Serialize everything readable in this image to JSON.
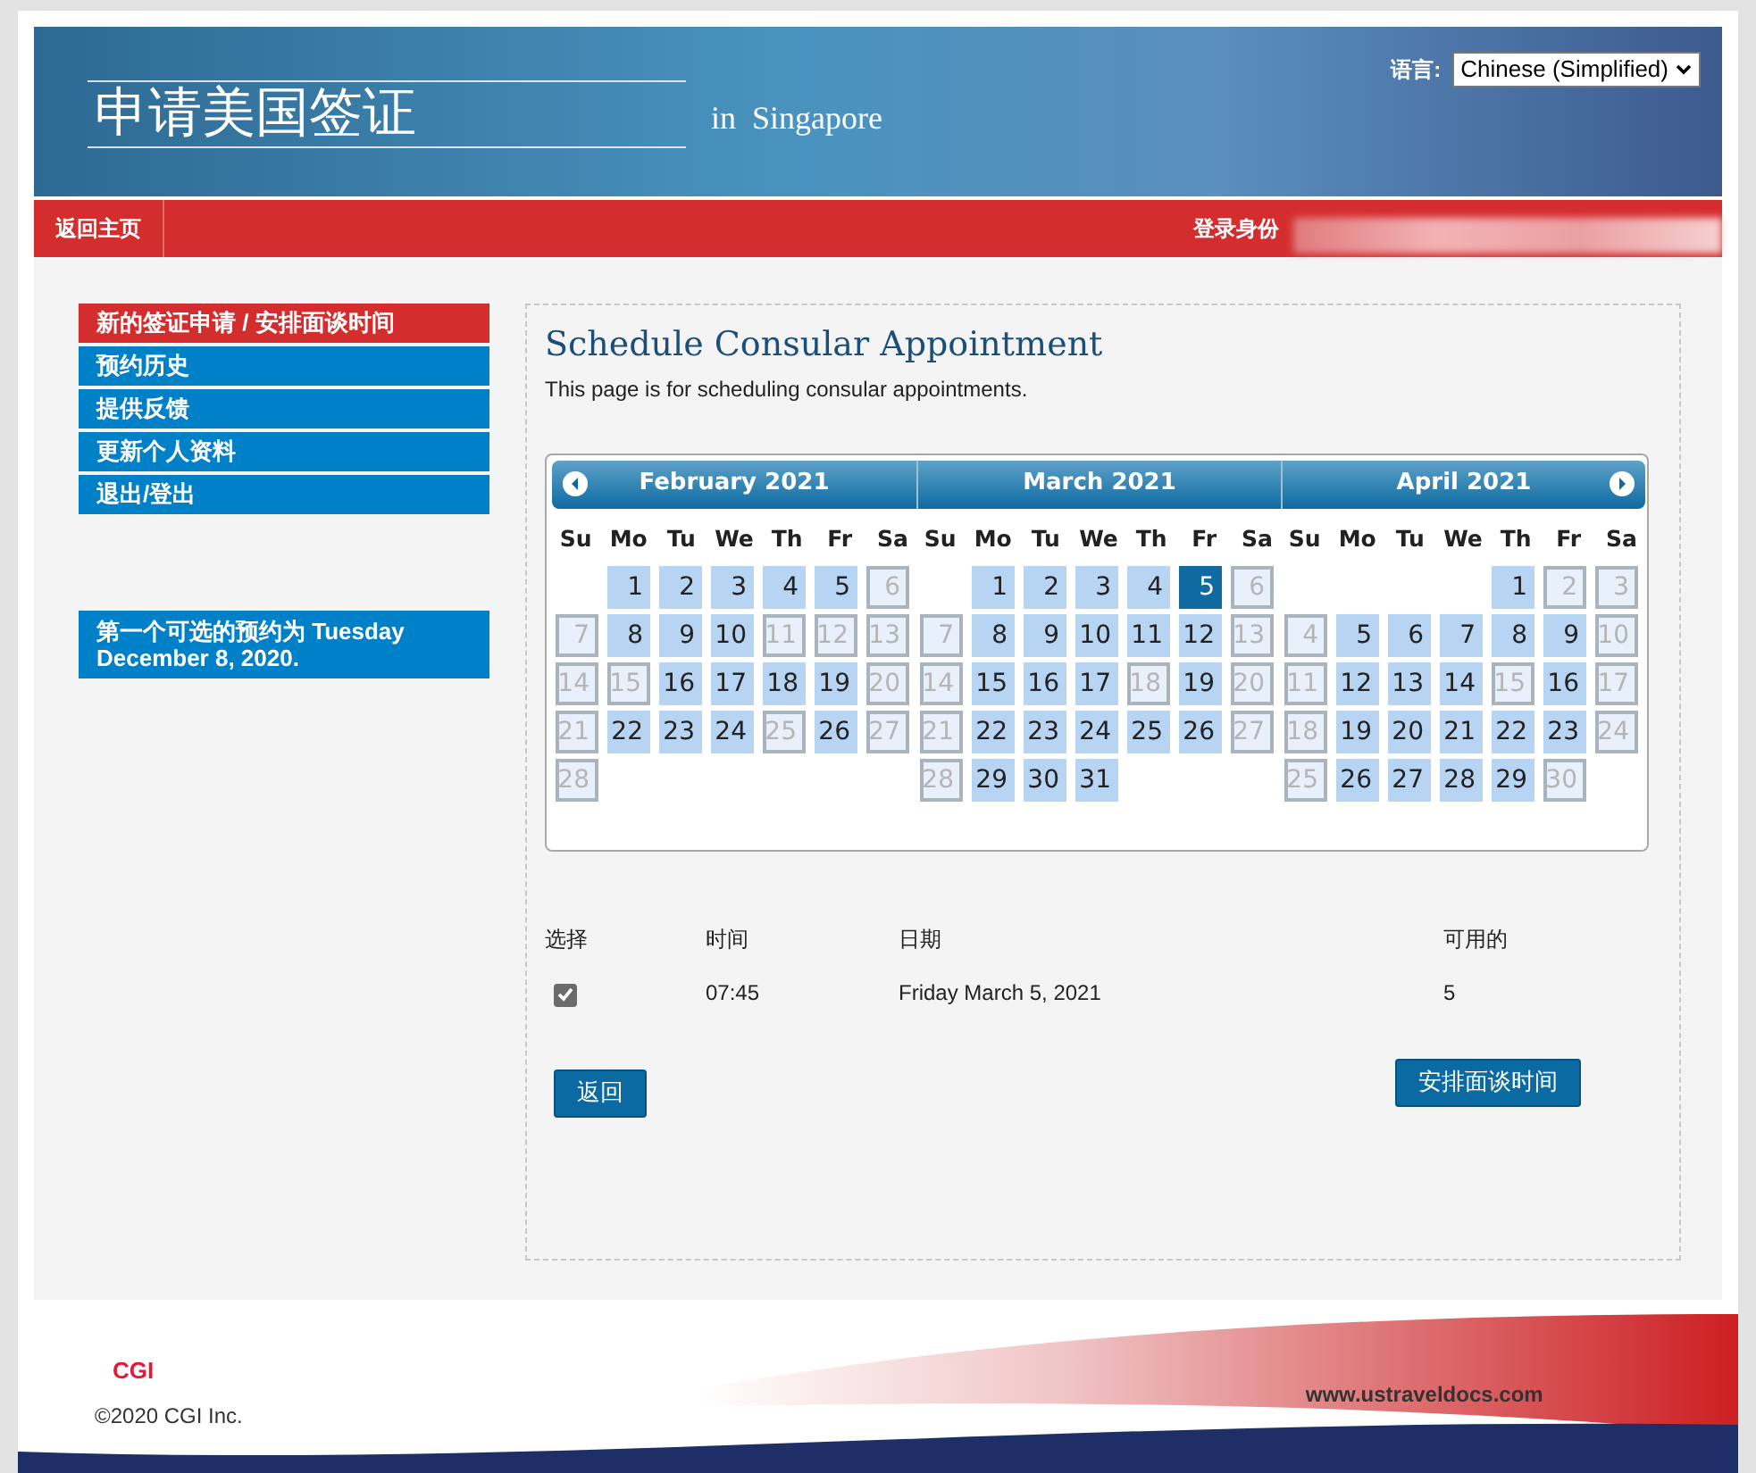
{
  "header": {
    "title": "申请美国签证",
    "location": "in  Singapore",
    "language_label": "语言:",
    "language_value": "Chinese (Simplified)"
  },
  "nav": {
    "home": "返回主页",
    "login_label": "登录身份"
  },
  "sidebar": {
    "items": [
      {
        "label": "新的签证申请 / 安排面谈时间",
        "selected": true
      },
      {
        "label": "预约历史",
        "selected": false
      },
      {
        "label": "提供反馈",
        "selected": false
      },
      {
        "label": "更新个人资料",
        "selected": false
      },
      {
        "label": "退出/登出",
        "selected": false
      }
    ],
    "notice": "第一个可选的预约为 Tuesday December 8, 2020."
  },
  "main": {
    "title": "Schedule Consular Appointment",
    "subtitle": "This page is for scheduling consular appointments."
  },
  "calendar": {
    "months": [
      {
        "title": "February 2021",
        "weekdays": [
          "Su",
          "Mo",
          "Tu",
          "We",
          "Th",
          "Fr",
          "Sa"
        ],
        "weeks": [
          [
            {
              "kind": "blank"
            },
            {
              "kind": "day",
              "t": "1",
              "available": true,
              "selected": false
            },
            {
              "kind": "day",
              "t": "2",
              "available": true,
              "selected": false
            },
            {
              "kind": "day",
              "t": "3",
              "available": true,
              "selected": false
            },
            {
              "kind": "day",
              "t": "4",
              "available": true,
              "selected": false
            },
            {
              "kind": "day",
              "t": "5",
              "available": true,
              "selected": false
            },
            {
              "kind": "day",
              "t": "6",
              "available": false,
              "selected": false
            }
          ],
          [
            {
              "kind": "day",
              "t": "7",
              "available": false,
              "selected": false
            },
            {
              "kind": "day",
              "t": "8",
              "available": true,
              "selected": false
            },
            {
              "kind": "day",
              "t": "9",
              "available": true,
              "selected": false
            },
            {
              "kind": "day",
              "t": "10",
              "available": true,
              "selected": false
            },
            {
              "kind": "day",
              "t": "11",
              "available": false,
              "selected": false
            },
            {
              "kind": "day",
              "t": "12",
              "available": false,
              "selected": false
            },
            {
              "kind": "day",
              "t": "13",
              "available": false,
              "selected": false
            }
          ],
          [
            {
              "kind": "day",
              "t": "14",
              "available": false,
              "selected": false
            },
            {
              "kind": "day",
              "t": "15",
              "available": false,
              "selected": false
            },
            {
              "kind": "day",
              "t": "16",
              "available": true,
              "selected": false
            },
            {
              "kind": "day",
              "t": "17",
              "available": true,
              "selected": false
            },
            {
              "kind": "day",
              "t": "18",
              "available": true,
              "selected": false
            },
            {
              "kind": "day",
              "t": "19",
              "available": true,
              "selected": false
            },
            {
              "kind": "day",
              "t": "20",
              "available": false,
              "selected": false
            }
          ],
          [
            {
              "kind": "day",
              "t": "21",
              "available": false,
              "selected": false
            },
            {
              "kind": "day",
              "t": "22",
              "available": true,
              "selected": false
            },
            {
              "kind": "day",
              "t": "23",
              "available": true,
              "selected": false
            },
            {
              "kind": "day",
              "t": "24",
              "available": true,
              "selected": false
            },
            {
              "kind": "day",
              "t": "25",
              "available": false,
              "selected": false
            },
            {
              "kind": "day",
              "t": "26",
              "available": true,
              "selected": false
            },
            {
              "kind": "day",
              "t": "27",
              "available": false,
              "selected": false
            }
          ],
          [
            {
              "kind": "day",
              "t": "28",
              "available": false,
              "selected": false
            }
          ]
        ]
      },
      {
        "title": "March 2021",
        "weekdays": [
          "Su",
          "Mo",
          "Tu",
          "We",
          "Th",
          "Fr",
          "Sa"
        ],
        "weeks": [
          [
            {
              "kind": "blank"
            },
            {
              "kind": "day",
              "t": "1",
              "available": true,
              "selected": false
            },
            {
              "kind": "day",
              "t": "2",
              "available": true,
              "selected": false
            },
            {
              "kind": "day",
              "t": "3",
              "available": true,
              "selected": false
            },
            {
              "kind": "day",
              "t": "4",
              "available": true,
              "selected": false
            },
            {
              "kind": "day",
              "t": "5",
              "available": true,
              "selected": true
            },
            {
              "kind": "day",
              "t": "6",
              "available": false,
              "selected": false
            }
          ],
          [
            {
              "kind": "day",
              "t": "7",
              "available": false,
              "selected": false
            },
            {
              "kind": "day",
              "t": "8",
              "available": true,
              "selected": false
            },
            {
              "kind": "day",
              "t": "9",
              "available": true,
              "selected": false
            },
            {
              "kind": "day",
              "t": "10",
              "available": true,
              "selected": false
            },
            {
              "kind": "day",
              "t": "11",
              "available": true,
              "selected": false
            },
            {
              "kind": "day",
              "t": "12",
              "available": true,
              "selected": false
            },
            {
              "kind": "day",
              "t": "13",
              "available": false,
              "selected": false
            }
          ],
          [
            {
              "kind": "day",
              "t": "14",
              "available": false,
              "selected": false
            },
            {
              "kind": "day",
              "t": "15",
              "available": true,
              "selected": false
            },
            {
              "kind": "day",
              "t": "16",
              "available": true,
              "selected": false
            },
            {
              "kind": "day",
              "t": "17",
              "available": true,
              "selected": false
            },
            {
              "kind": "day",
              "t": "18",
              "available": false,
              "selected": false
            },
            {
              "kind": "day",
              "t": "19",
              "available": true,
              "selected": false
            },
            {
              "kind": "day",
              "t": "20",
              "available": false,
              "selected": false
            }
          ],
          [
            {
              "kind": "day",
              "t": "21",
              "available": false,
              "selected": false
            },
            {
              "kind": "day",
              "t": "22",
              "available": true,
              "selected": false
            },
            {
              "kind": "day",
              "t": "23",
              "available": true,
              "selected": false
            },
            {
              "kind": "day",
              "t": "24",
              "available": true,
              "selected": false
            },
            {
              "kind": "day",
              "t": "25",
              "available": true,
              "selected": false
            },
            {
              "kind": "day",
              "t": "26",
              "available": true,
              "selected": false
            },
            {
              "kind": "day",
              "t": "27",
              "available": false,
              "selected": false
            }
          ],
          [
            {
              "kind": "day",
              "t": "28",
              "available": false,
              "selected": false
            },
            {
              "kind": "day",
              "t": "29",
              "available": true,
              "selected": false
            },
            {
              "kind": "day",
              "t": "30",
              "available": true,
              "selected": false
            },
            {
              "kind": "day",
              "t": "31",
              "available": true,
              "selected": false
            }
          ]
        ]
      },
      {
        "title": "April 2021",
        "weekdays": [
          "Su",
          "Mo",
          "Tu",
          "We",
          "Th",
          "Fr",
          "Sa"
        ],
        "weeks": [
          [
            {
              "kind": "blank"
            },
            {
              "kind": "blank"
            },
            {
              "kind": "blank"
            },
            {
              "kind": "blank"
            },
            {
              "kind": "day",
              "t": "1",
              "available": true,
              "selected": false
            },
            {
              "kind": "day",
              "t": "2",
              "available": false,
              "selected": false
            },
            {
              "kind": "day",
              "t": "3",
              "available": false,
              "selected": false
            }
          ],
          [
            {
              "kind": "day",
              "t": "4",
              "available": false,
              "selected": false
            },
            {
              "kind": "day",
              "t": "5",
              "available": true,
              "selected": false
            },
            {
              "kind": "day",
              "t": "6",
              "available": true,
              "selected": false
            },
            {
              "kind": "day",
              "t": "7",
              "available": true,
              "selected": false
            },
            {
              "kind": "day",
              "t": "8",
              "available": true,
              "selected": false
            },
            {
              "kind": "day",
              "t": "9",
              "available": true,
              "selected": false
            },
            {
              "kind": "day",
              "t": "10",
              "available": false,
              "selected": false
            }
          ],
          [
            {
              "kind": "day",
              "t": "11",
              "available": false,
              "selected": false
            },
            {
              "kind": "day",
              "t": "12",
              "available": true,
              "selected": false
            },
            {
              "kind": "day",
              "t": "13",
              "available": true,
              "selected": false
            },
            {
              "kind": "day",
              "t": "14",
              "available": true,
              "selected": false
            },
            {
              "kind": "day",
              "t": "15",
              "available": false,
              "selected": false
            },
            {
              "kind": "day",
              "t": "16",
              "available": true,
              "selected": false
            },
            {
              "kind": "day",
              "t": "17",
              "available": false,
              "selected": false
            }
          ],
          [
            {
              "kind": "day",
              "t": "18",
              "available": false,
              "selected": false
            },
            {
              "kind": "day",
              "t": "19",
              "available": true,
              "selected": false
            },
            {
              "kind": "day",
              "t": "20",
              "available": true,
              "selected": false
            },
            {
              "kind": "day",
              "t": "21",
              "available": true,
              "selected": false
            },
            {
              "kind": "day",
              "t": "22",
              "available": true,
              "selected": false
            },
            {
              "kind": "day",
              "t": "23",
              "available": true,
              "selected": false
            },
            {
              "kind": "day",
              "t": "24",
              "available": false,
              "selected": false
            }
          ],
          [
            {
              "kind": "day",
              "t": "25",
              "available": false,
              "selected": false
            },
            {
              "kind": "day",
              "t": "26",
              "available": true,
              "selected": false
            },
            {
              "kind": "day",
              "t": "27",
              "available": true,
              "selected": false
            },
            {
              "kind": "day",
              "t": "28",
              "available": true,
              "selected": false
            },
            {
              "kind": "day",
              "t": "29",
              "available": true,
              "selected": false
            },
            {
              "kind": "day",
              "t": "30",
              "available": false,
              "selected": false
            }
          ]
        ]
      }
    ]
  },
  "slots": {
    "columns": [
      "选择",
      "时间",
      "日期",
      "可用的"
    ],
    "rows": [
      {
        "checked": true,
        "time": "07:45",
        "date": "Friday March 5, 2021",
        "available": "5"
      }
    ]
  },
  "buttons": {
    "back": "返回",
    "schedule": "安排面谈时间"
  },
  "footer": {
    "logo": "CGI",
    "copyright": "©2020 CGI Inc.",
    "site": "www.ustraveldocs.com"
  }
}
